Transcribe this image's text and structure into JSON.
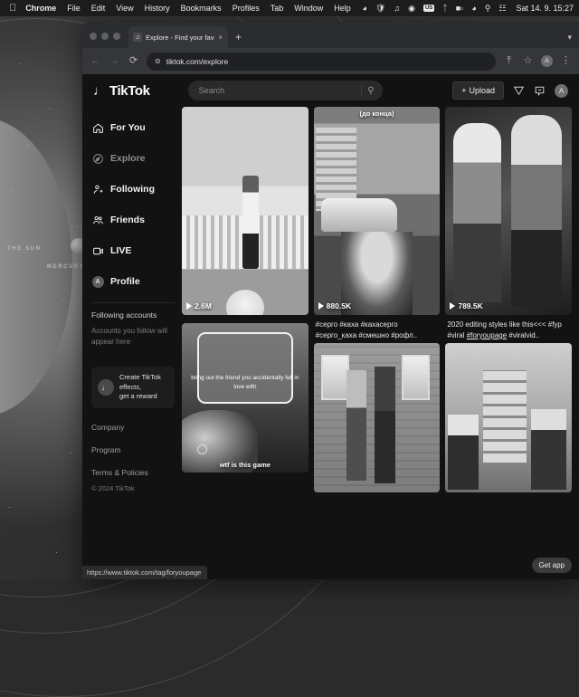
{
  "menubar": {
    "apple_icon": "apple-icon",
    "items": [
      "Chrome",
      "File",
      "Edit",
      "View",
      "History",
      "Bookmarks",
      "Profiles",
      "Tab",
      "Window",
      "Help"
    ],
    "status_icons": [
      "screen-record-icon",
      "shield-icon",
      "music-icon",
      "control-center-icon"
    ],
    "input_badge": "US",
    "more_icons": [
      "bluetooth-icon",
      "battery-icon",
      "wifi-icon",
      "search-icon",
      "control-center-icon"
    ],
    "clock": "Sat 14. 9. 15:27"
  },
  "browser": {
    "tab": {
      "title": "Explore - Find your favourite",
      "favicon": "tiktok-note-icon",
      "close_label": "×"
    },
    "new_tab_label": "+",
    "tabstrip_menu": "chevron-down-icon",
    "toolbar": {
      "back": "←",
      "forward": "→",
      "reload": "⟳",
      "site_info_icon": "page-info-icon",
      "url": "tiktok.com/explore",
      "share_icon": "share-icon",
      "bookmark_icon": "star-icon",
      "profile_initial": "A",
      "menu_icon": "kebab-menu-icon"
    }
  },
  "tiktok": {
    "logo_text": "TikTok",
    "logo_icon": "tiktok-note-icon",
    "search": {
      "placeholder": "Search",
      "value": "",
      "icon": "search-icon"
    },
    "upload_label": "Upload",
    "upload_plus": "+",
    "send_icon": "paper-plane-icon",
    "inbox_icon": "message-icon",
    "avatar_initial": "A",
    "sidebar": {
      "nav": [
        {
          "label": "For You",
          "icon": "home-icon",
          "active": false
        },
        {
          "label": "Explore",
          "icon": "compass-icon",
          "active": true
        },
        {
          "label": "Following",
          "icon": "person-plus-icon",
          "active": false
        },
        {
          "label": "Friends",
          "icon": "people-icon",
          "active": false
        },
        {
          "label": "LIVE",
          "icon": "live-icon",
          "active": false
        },
        {
          "label": "Profile",
          "icon": "avatar-icon",
          "active": false
        }
      ],
      "following_title": "Following accounts",
      "following_sub": "Accounts you follow will appear here",
      "promo": {
        "icon": "tiktok-note-icon",
        "line1": "Create TikTok effects,",
        "line2": "get a reward"
      },
      "links": [
        "Company",
        "Program",
        "Terms & Policies"
      ],
      "copyright": "© 2024 TikTok"
    },
    "videos": [
      {
        "views": "2.6M",
        "caption": "",
        "overlay": ""
      },
      {
        "views": "880.5K",
        "caption": "#серго #каха #кахасерго #серго_каха #смешно #рофл..",
        "overlay": "(до конца)"
      },
      {
        "views": "789.5K",
        "caption_part1": "2020 editing styles like this<<< #fyp #viral ",
        "caption_link": "#foryoupage",
        "caption_part2": " #viralvid..",
        "overlay": ""
      },
      {
        "views": "",
        "caption": "",
        "card_text": "bring out the friend you accidentally fell in love with",
        "bottom_text": "wtf is this game"
      },
      {
        "views": "",
        "caption": "",
        "overlay": ""
      },
      {
        "views": "",
        "caption": "",
        "overlay": ""
      }
    ],
    "get_app_label": "Get app"
  },
  "status_url": "https://www.tiktok.com/tag/foryoupage",
  "wallpaper": {
    "label_sun": "THE SUN",
    "label_mercury": "MERCURY"
  }
}
